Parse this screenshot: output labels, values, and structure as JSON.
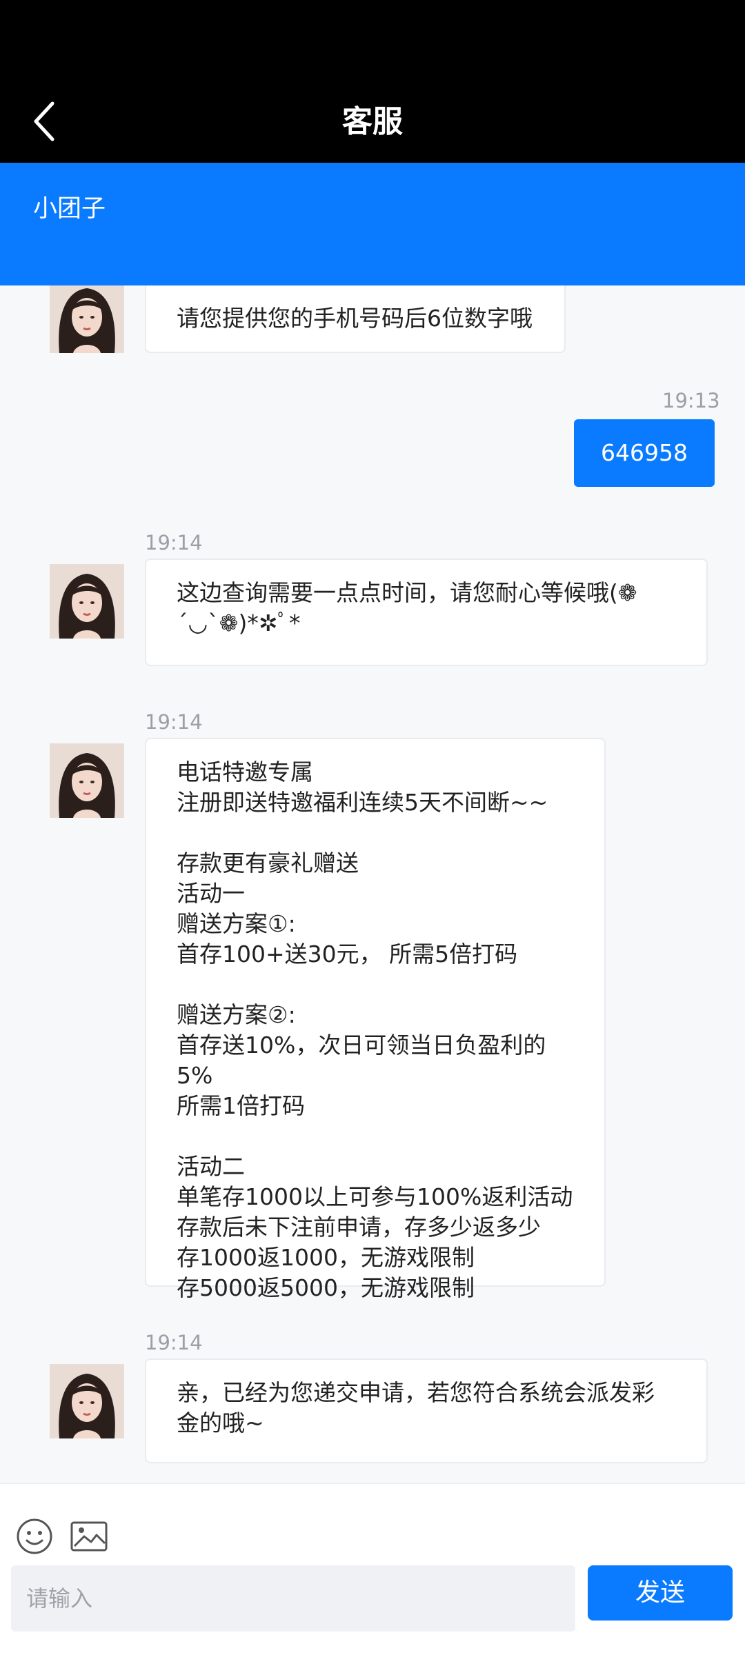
{
  "header": {
    "title": "客服",
    "back_icon": "chevron-left-icon",
    "background": "#000000"
  },
  "agent_bar": {
    "name": "小团子",
    "background": "#0a7bff"
  },
  "messages": [
    {
      "side": "agent",
      "time": "",
      "text": "请您提供您的手机号码后6位数字哦"
    },
    {
      "side": "user",
      "time": "19:13",
      "text": "646958"
    },
    {
      "side": "agent",
      "time": "19:14",
      "text": "这边查询需要一点点时间，请您耐心等候哦(❁\n´◡`❁)*✲ﾟ*"
    },
    {
      "side": "agent",
      "time": "19:14",
      "text": "电话特邀专属\n注册即送特邀福利连续5天不间断~~\n\n存款更有豪礼赠送\n活动一\n赠送方案①:\n首存100+送30元， 所需5倍打码\n\n赠送方案②:\n首存送10%，次日可领当日负盈利的5%\n所需1倍打码\n\n活动二\n单笔存1000以上可参与100%返利活动\n存款后未下注前申请，存多少返多少\n存1000返1000，无游戏限制\n存5000返5000，无游戏限制"
    },
    {
      "side": "agent",
      "time": "19:14",
      "text": "亲，已经为您递交申请，若您符合系统会派发彩\n金的哦~"
    }
  ],
  "composer": {
    "emoji_icon": "emoji-icon",
    "image_icon": "image-icon",
    "placeholder": "请输入",
    "send_label": "发送",
    "accent": "#0a7bff"
  }
}
